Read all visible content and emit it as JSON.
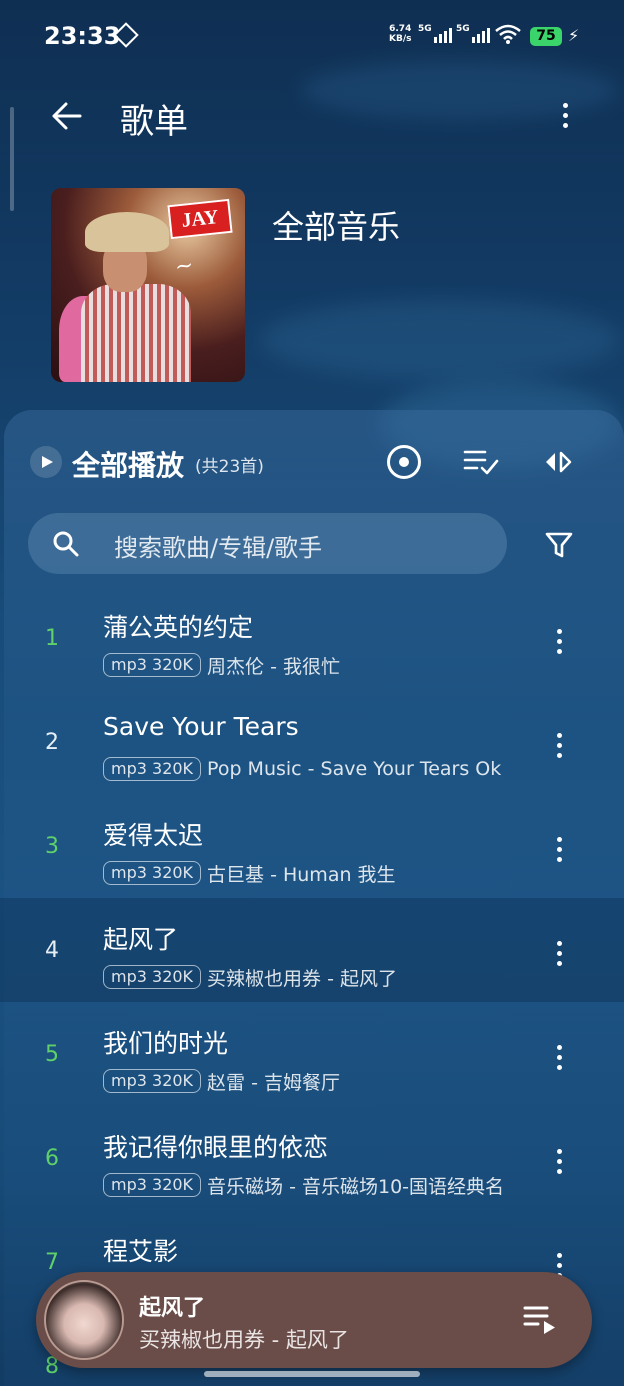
{
  "status_bar": {
    "time": "23:33",
    "net_speed_value": "6.74",
    "net_speed_unit": "KB/s",
    "sim1": "5G",
    "sim2": "5G",
    "battery": "75"
  },
  "header": {
    "title": "歌单"
  },
  "playlist": {
    "name": "全部音乐",
    "cover_badge": "JAY"
  },
  "toolbar": {
    "play_all_label": "全部播放",
    "count_label": "(共23首)"
  },
  "search": {
    "placeholder": "搜索歌曲/专辑/歌手"
  },
  "songs": [
    {
      "index": "1",
      "title": "蒲公英的约定",
      "quality": "mp3 320K",
      "meta": "周杰伦 - 我很忙"
    },
    {
      "index": "2",
      "title": "Save Your Tears",
      "quality": "mp3 320K",
      "meta": "Pop Music - Save Your Tears Ok"
    },
    {
      "index": "3",
      "title": "爱得太迟",
      "quality": "mp3 320K",
      "meta": "古巨基 - Human 我生"
    },
    {
      "index": "4",
      "title": "起风了",
      "quality": "mp3 320K",
      "meta": "买辣椒也用券 - 起风了"
    },
    {
      "index": "5",
      "title": "我们的时光",
      "quality": "mp3 320K",
      "meta": "赵雷 - 吉姆餐厅"
    },
    {
      "index": "6",
      "title": "我记得你眼里的依恋",
      "quality": "mp3 320K",
      "meta": "音乐磁场 - 音乐磁场10-国语经典名"
    },
    {
      "index": "7",
      "title": "程艾影",
      "quality": "",
      "meta": ""
    },
    {
      "index": "8",
      "title": "",
      "quality": "",
      "meta": ""
    }
  ],
  "now_playing": {
    "title": "起风了",
    "subtitle": "买辣椒也用券 - 起风了"
  },
  "colors": {
    "index_green": "#5fd06a",
    "index_white": "#e6eef6",
    "mini_player_bg": "#6a4c48"
  },
  "icons": [
    "back-arrow-icon",
    "more-vertical-icon",
    "play-icon",
    "locate-icon",
    "multiselect-list-icon",
    "sort-icon",
    "search-icon",
    "filter-icon",
    "playlist-queue-icon"
  ]
}
